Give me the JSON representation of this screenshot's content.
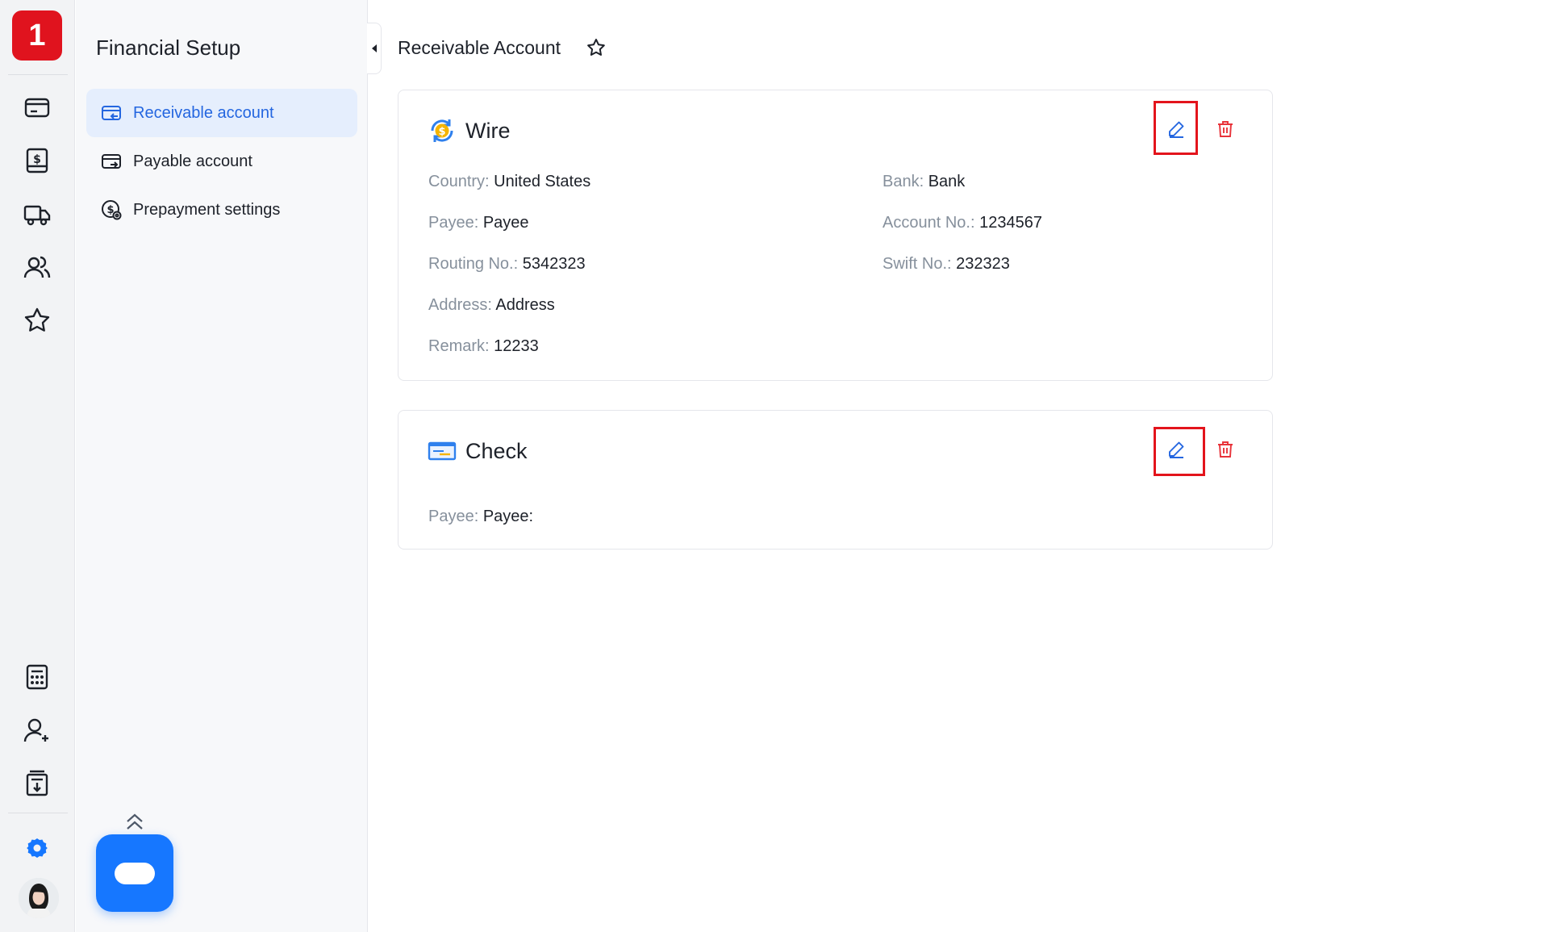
{
  "app": {
    "logo_text": "1",
    "brand_color": "#e0131e",
    "accent_color": "#1677ff"
  },
  "rail": {
    "top_icons": [
      "card-icon",
      "invoice-dollar-icon",
      "truck-icon",
      "contacts-icon",
      "star-icon"
    ],
    "bottom_icons": [
      "calculator-icon",
      "add-user-icon",
      "report-download-icon",
      "settings-gear-icon",
      "user-avatar"
    ]
  },
  "sidebar": {
    "title": "Financial Setup",
    "items": [
      {
        "label": "Receivable account",
        "icon": "receivable-card-icon",
        "active": true
      },
      {
        "label": "Payable account",
        "icon": "payable-card-icon",
        "active": false
      },
      {
        "label": "Prepayment settings",
        "icon": "prepayment-dollar-icon",
        "active": false
      }
    ]
  },
  "header": {
    "title": "Receivable Account",
    "favorite_icon": "star-outline-icon"
  },
  "accounts": [
    {
      "type": "Wire",
      "icon": "wire-dollar-icon",
      "fields": {
        "country_label": "Country:",
        "country": "United States",
        "bank_label": "Bank:",
        "bank": "Bank",
        "payee_label": "Payee:",
        "payee": "Payee",
        "account_no_label": "Account No.:",
        "account_no": "1234567",
        "routing_no_label": "Routing No.:",
        "routing_no": "5342323",
        "swift_no_label": "Swift No.:",
        "swift_no": "232323",
        "address_label": "Address:",
        "address": "Address",
        "remark_label": "Remark:",
        "remark": "12233"
      }
    },
    {
      "type": "Check",
      "icon": "check-card-icon",
      "fields": {
        "payee_label": "Payee:",
        "payee": "Payee:"
      }
    }
  ],
  "colors": {
    "edit": "#2466e0",
    "delete": "#e8333a",
    "highlight": "#e3141c",
    "label_gray": "#86909c"
  }
}
